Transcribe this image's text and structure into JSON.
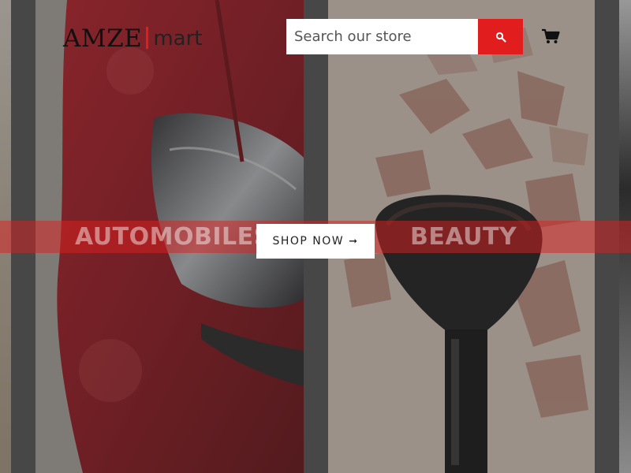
{
  "header": {
    "logo_primary": "AMZE",
    "logo_secondary": "mart",
    "search_placeholder": "Search our store",
    "search_icon": "search-icon",
    "cart_icon": "cart-icon"
  },
  "hero": {
    "categories": [
      {
        "label": "AUTOMOBILES",
        "image": "red car headlight"
      },
      {
        "label": "BEAUTY",
        "image": "makeup brush and crushed powder"
      }
    ],
    "cta_label": "SHOP NOW",
    "cta_icon": "arrow-right-icon",
    "banner_color": "#e21d1d"
  },
  "colors": {
    "accent": "#e21d1d",
    "logo_text": "#111111"
  }
}
